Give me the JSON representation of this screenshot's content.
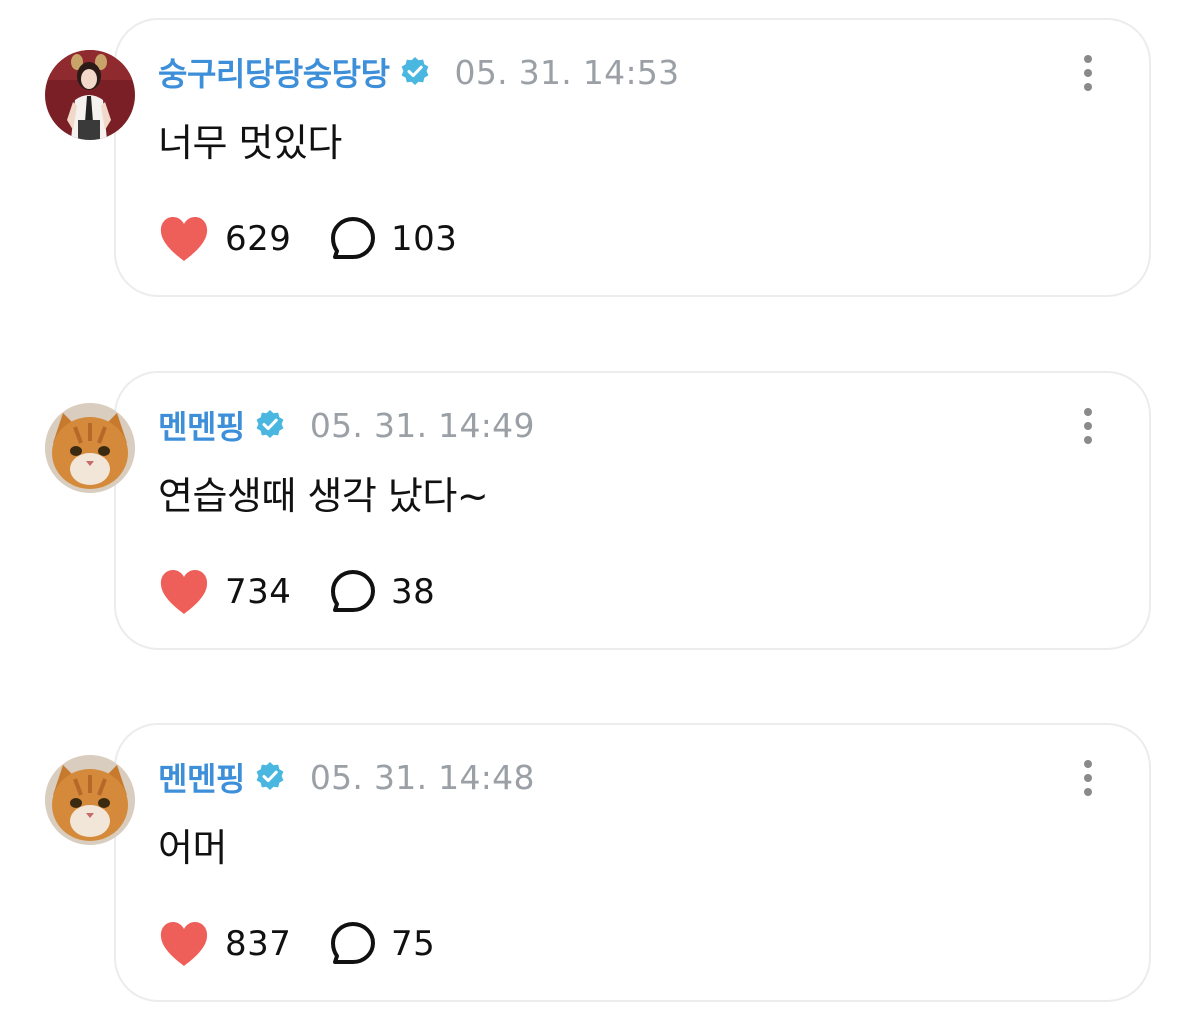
{
  "colors": {
    "username": "#3d8fd9",
    "verified_badge": "#4ab7e0",
    "timestamp": "#9aa0a6",
    "heart": "#ef5f5a",
    "card_border": "#ececec"
  },
  "comments": [
    {
      "username": "숭구리당당숭당당",
      "verified": true,
      "timestamp": "05. 31. 14:53",
      "text": "너무 멋있다",
      "likes": "629",
      "replies": "103",
      "avatar": "girl-avatar"
    },
    {
      "username": "멘멘핑",
      "verified": true,
      "timestamp": "05. 31. 14:49",
      "text": "연습생때 생각 났다~",
      "likes": "734",
      "replies": "38",
      "avatar": "cat-avatar"
    },
    {
      "username": "멘멘핑",
      "verified": true,
      "timestamp": "05. 31. 14:48",
      "text": "어머",
      "likes": "837",
      "replies": "75",
      "avatar": "cat-avatar"
    }
  ]
}
